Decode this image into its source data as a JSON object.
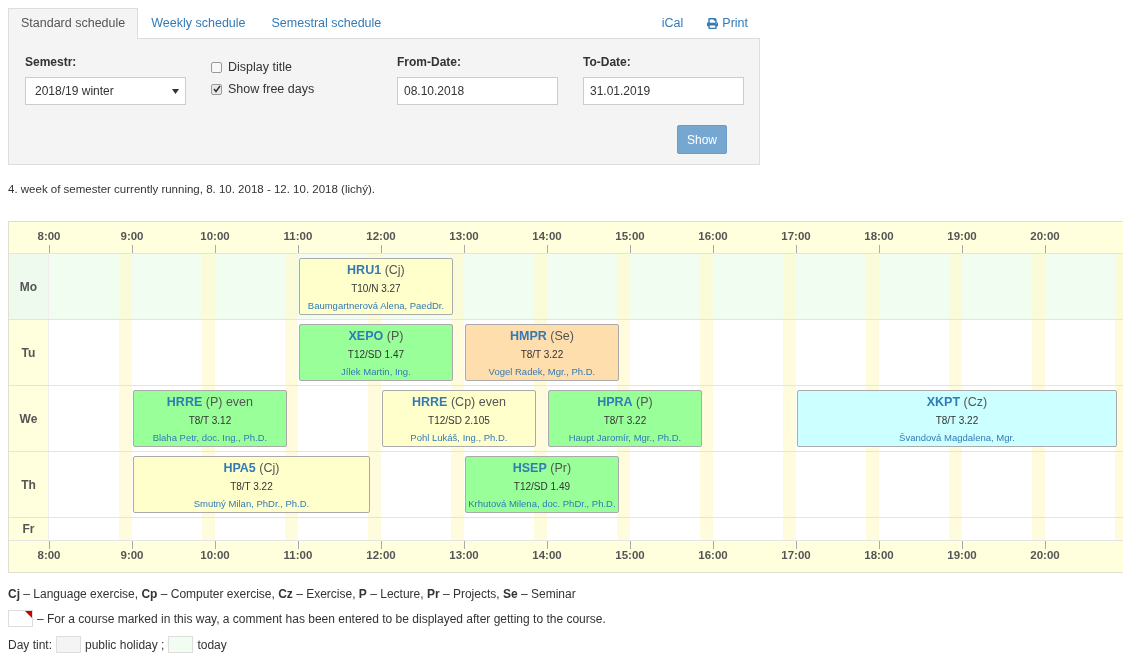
{
  "tabs": [
    {
      "label": "Standard schedule",
      "selected": true
    },
    {
      "label": "Weekly schedule",
      "selected": false
    },
    {
      "label": "Semestral schedule",
      "selected": false
    }
  ],
  "links": [
    {
      "label": "iCal",
      "kind": "plain"
    },
    {
      "label": "Print",
      "kind": "print"
    }
  ],
  "filter": {
    "semester_label": "Semestr:",
    "semester_value": "2018/19 winter",
    "checkboxes": [
      {
        "label": "Display title",
        "checked": false
      },
      {
        "label": "Show free days",
        "checked": true
      }
    ],
    "from_label": "From-Date:",
    "from_value": "08.10.2018",
    "to_label": "To-Date:",
    "to_value": "31.01.2019",
    "button": "Show"
  },
  "week_info": "4. week of semester currently running, 8. 10. 2018 - 12. 10. 2018 (lichý).",
  "schedule": {
    "hours_top": [
      "8:00",
      "9:00",
      "10:00",
      "11:00",
      "12:00",
      "13:00",
      "14:00",
      "15:00",
      "16:00",
      "17:00",
      "18:00",
      "19:00",
      "20:00"
    ],
    "days": [
      {
        "name": "Mo",
        "today": true,
        "events": [
          {
            "code": "HRU1",
            "type": "(Cj)",
            "room": "T10/N 3.27",
            "teacher": "Baumgartnerová Alena, PaedDr.",
            "color": "#ffffcc"
          }
        ]
      },
      {
        "name": "Tu",
        "today": false,
        "events": [
          {
            "code": "XEPO",
            "type": "(P)",
            "room": "T12/SD 1.47",
            "teacher": "Jílek Martin, Ing.",
            "color": "#99ff99"
          },
          {
            "code": "HMPR",
            "type": "(Se)",
            "room": "T8/T 3.22",
            "teacher": "Vogel Radek, Mgr., Ph.D.",
            "color": "#ffdead"
          }
        ]
      },
      {
        "name": "We",
        "today": false,
        "events": [
          {
            "code": "HRRE",
            "type": "(P)",
            "parity": "even",
            "room": "T8/T 3.12",
            "teacher": "Blaha Petr, doc. Ing., Ph.D.",
            "color": "#99ff99"
          },
          {
            "code": "HRRE",
            "type": "(Cp)",
            "parity": "even",
            "room": "T12/SD 2.105",
            "teacher": "Pohl Lukáš, Ing., Ph.D.",
            "color": "#ffffcc"
          },
          {
            "code": "HPRA",
            "type": "(P)",
            "room": "T8/T 3.22",
            "teacher": "Haupt Jaromír, Mgr., Ph.D.",
            "color": "#99ff99"
          },
          {
            "code": "XKPT",
            "type": "(Cz)",
            "room": "T8/T 3.22",
            "teacher": "Švandová Magdalena, Mgr.",
            "color": "#ccffff"
          }
        ]
      },
      {
        "name": "Th",
        "today": false,
        "events": [
          {
            "code": "HPA5",
            "type": "(Cj)",
            "room": "T8/T 3.22",
            "teacher": "Smutný Milan, PhDr., Ph.D.",
            "color": "#ffffcc"
          },
          {
            "code": "HSEP",
            "type": "(Pr)",
            "room": "T12/SD 1.49",
            "teacher": "Krhutová Milena, doc. PhDr., Ph.D.",
            "color": "#99ff99"
          }
        ]
      },
      {
        "name": "Fr",
        "today": false
      }
    ],
    "hours_bottom": [
      "8:00",
      "9:00",
      "10:00",
      "11:00",
      "12:00",
      "13:00",
      "14:00",
      "15:00",
      "16:00",
      "17:00",
      "18:00",
      "19:00",
      "20:00"
    ]
  },
  "legend": {
    "types": "**Cj** – Language exercise, **Cp** – Computer exercise, **Cz** – Exercise, **P** – Lecture, **Pr** – Projects, **Se** – Seminar",
    "comment_note": "– For a course marked in this way, a comment has been entered to be displayed after getting to the course.",
    "tint_label": "Day tint:",
    "holiday_label": "public holiday ;",
    "today_label": "today"
  }
}
